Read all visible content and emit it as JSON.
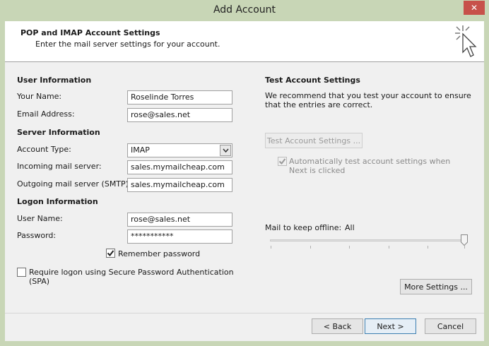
{
  "window": {
    "title": "Add Account",
    "close_glyph": "✕"
  },
  "header": {
    "title": "POP and IMAP Account Settings",
    "subtitle": "Enter the mail server settings for your account.",
    "icon": "cursor-click-icon"
  },
  "user_info": {
    "heading": "User Information",
    "name_label": "Your Name:",
    "name_value": "Roselinde Torres",
    "email_label": "Email Address:",
    "email_value": "rose@sales.net"
  },
  "server_info": {
    "heading": "Server Information",
    "account_type_label": "Account Type:",
    "account_type_value": "IMAP",
    "incoming_label": "Incoming mail server:",
    "incoming_value": "sales.mymailcheap.com",
    "outgoing_label": "Outgoing mail server (SMTP):",
    "outgoing_value": "sales.mymailcheap.com"
  },
  "logon_info": {
    "heading": "Logon Information",
    "username_label": "User Name:",
    "username_value": "rose@sales.net",
    "password_label": "Password:",
    "password_value": "***********",
    "remember_label": "Remember password",
    "remember_checked": true,
    "spa_label": "Require logon using Secure Password Authentication (SPA)",
    "spa_checked": false
  },
  "test_settings": {
    "heading": "Test Account Settings",
    "description": "We recommend that you test your account to ensure that the entries are correct.",
    "test_button": "Test Account Settings ...",
    "auto_test_label": "Automatically test account settings when Next is clicked",
    "auto_test_checked": true
  },
  "offline": {
    "label": "Mail to keep offline:",
    "value": "All",
    "slider_fraction": 1.0
  },
  "buttons": {
    "more_settings": "More Settings ...",
    "back": "< Back",
    "next": "Next >",
    "cancel": "Cancel"
  },
  "colors": {
    "window_frame": "#c8d6b6",
    "close_button": "#c7514a",
    "default_button_border": "#3c7fb1"
  }
}
